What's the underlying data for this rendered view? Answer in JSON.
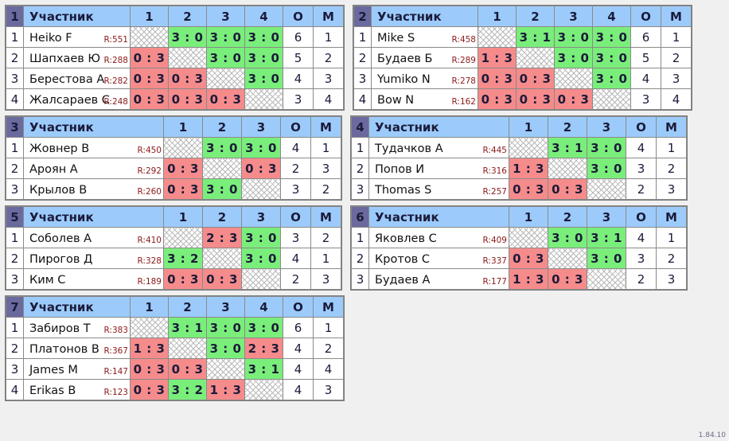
{
  "app": {
    "version": "1.84.10",
    "headers": {
      "participant": "Участник",
      "points": "О",
      "place": "М"
    },
    "colors": {
      "header_blue": "#9ccbfb",
      "group_badge": "#6a6a9e",
      "win_green": "#7aee7a",
      "loss_red": "#f58b8b",
      "rating_text": "#8b1a1a",
      "page_background": "#f0f0f0"
    }
  },
  "groups": [
    {
      "number": "1",
      "opponent_columns": [
        "1",
        "2",
        "3",
        "4"
      ],
      "rows": [
        {
          "rank": "1",
          "name": "Heiko F",
          "rating": "R:551",
          "cells": [
            {
              "text": "",
              "state": "none"
            },
            {
              "text": "3 : 0",
              "state": "win"
            },
            {
              "text": "3 : 0",
              "state": "win"
            },
            {
              "text": "3 : 0",
              "state": "win"
            }
          ],
          "points": "6",
          "place": "1"
        },
        {
          "rank": "2",
          "name": "Шапхаев Ю",
          "rating": "R:288",
          "cells": [
            {
              "text": "0 : 3",
              "state": "loss"
            },
            {
              "text": "",
              "state": "none"
            },
            {
              "text": "3 : 0",
              "state": "win"
            },
            {
              "text": "3 : 0",
              "state": "win"
            }
          ],
          "points": "5",
          "place": "2"
        },
        {
          "rank": "3",
          "name": "Берестова А",
          "rating": "R:282",
          "cells": [
            {
              "text": "0 : 3",
              "state": "loss"
            },
            {
              "text": "0 : 3",
              "state": "loss"
            },
            {
              "text": "",
              "state": "none"
            },
            {
              "text": "3 : 0",
              "state": "win"
            }
          ],
          "points": "4",
          "place": "3"
        },
        {
          "rank": "4",
          "name": "Жалсараев С",
          "rating": "R:248",
          "cells": [
            {
              "text": "0 : 3",
              "state": "loss"
            },
            {
              "text": "0 : 3",
              "state": "loss"
            },
            {
              "text": "0 : 3",
              "state": "loss"
            },
            {
              "text": "",
              "state": "none"
            }
          ],
          "points": "3",
          "place": "4"
        }
      ]
    },
    {
      "number": "2",
      "opponent_columns": [
        "1",
        "2",
        "3",
        "4"
      ],
      "rows": [
        {
          "rank": "1",
          "name": "Mike S",
          "rating": "R:458",
          "cells": [
            {
              "text": "",
              "state": "none"
            },
            {
              "text": "3 : 1",
              "state": "win"
            },
            {
              "text": "3 : 0",
              "state": "win"
            },
            {
              "text": "3 : 0",
              "state": "win"
            }
          ],
          "points": "6",
          "place": "1"
        },
        {
          "rank": "2",
          "name": "Будаев Б",
          "rating": "R:289",
          "cells": [
            {
              "text": "1 : 3",
              "state": "loss"
            },
            {
              "text": "",
              "state": "none"
            },
            {
              "text": "3 : 0",
              "state": "win"
            },
            {
              "text": "3 : 0",
              "state": "win"
            }
          ],
          "points": "5",
          "place": "2"
        },
        {
          "rank": "3",
          "name": "Yumiko N",
          "rating": "R:278",
          "cells": [
            {
              "text": "0 : 3",
              "state": "loss"
            },
            {
              "text": "0 : 3",
              "state": "loss"
            },
            {
              "text": "",
              "state": "none"
            },
            {
              "text": "3 : 0",
              "state": "win"
            }
          ],
          "points": "4",
          "place": "3"
        },
        {
          "rank": "4",
          "name": "Bow N",
          "rating": "R:162",
          "cells": [
            {
              "text": "0 : 3",
              "state": "loss"
            },
            {
              "text": "0 : 3",
              "state": "loss"
            },
            {
              "text": "0 : 3",
              "state": "loss"
            },
            {
              "text": "",
              "state": "none"
            }
          ],
          "points": "3",
          "place": "4"
        }
      ]
    },
    {
      "number": "3",
      "opponent_columns": [
        "1",
        "2",
        "3"
      ],
      "rows": [
        {
          "rank": "1",
          "name": "Жовнер В",
          "rating": "R:450",
          "cells": [
            {
              "text": "",
              "state": "none"
            },
            {
              "text": "3 : 0",
              "state": "win"
            },
            {
              "text": "3 : 0",
              "state": "win"
            }
          ],
          "points": "4",
          "place": "1"
        },
        {
          "rank": "2",
          "name": "Ароян А",
          "rating": "R:292",
          "cells": [
            {
              "text": "0 : 3",
              "state": "loss"
            },
            {
              "text": "",
              "state": "none"
            },
            {
              "text": "0 : 3",
              "state": "loss"
            }
          ],
          "points": "2",
          "place": "3"
        },
        {
          "rank": "3",
          "name": "Крылов В",
          "rating": "R:260",
          "cells": [
            {
              "text": "0 : 3",
              "state": "loss"
            },
            {
              "text": "3 : 0",
              "state": "win"
            },
            {
              "text": "",
              "state": "none"
            }
          ],
          "points": "3",
          "place": "2"
        }
      ]
    },
    {
      "number": "4",
      "opponent_columns": [
        "1",
        "2",
        "3"
      ],
      "rows": [
        {
          "rank": "1",
          "name": "Тудачков А",
          "rating": "R:445",
          "cells": [
            {
              "text": "",
              "state": "none"
            },
            {
              "text": "3 : 1",
              "state": "win"
            },
            {
              "text": "3 : 0",
              "state": "win"
            }
          ],
          "points": "4",
          "place": "1"
        },
        {
          "rank": "2",
          "name": "Попов И",
          "rating": "R:316",
          "cells": [
            {
              "text": "1 : 3",
              "state": "loss"
            },
            {
              "text": "",
              "state": "none"
            },
            {
              "text": "3 : 0",
              "state": "win"
            }
          ],
          "points": "3",
          "place": "2"
        },
        {
          "rank": "3",
          "name": "Thomas S",
          "rating": "R:257",
          "cells": [
            {
              "text": "0 : 3",
              "state": "loss"
            },
            {
              "text": "0 : 3",
              "state": "loss"
            },
            {
              "text": "",
              "state": "none"
            }
          ],
          "points": "2",
          "place": "3"
        }
      ]
    },
    {
      "number": "5",
      "opponent_columns": [
        "1",
        "2",
        "3"
      ],
      "rows": [
        {
          "rank": "1",
          "name": "Соболев А",
          "rating": "R:410",
          "cells": [
            {
              "text": "",
              "state": "none"
            },
            {
              "text": "2 : 3",
              "state": "loss"
            },
            {
              "text": "3 : 0",
              "state": "win"
            }
          ],
          "points": "3",
          "place": "2"
        },
        {
          "rank": "2",
          "name": "Пирогов Д",
          "rating": "R:328",
          "cells": [
            {
              "text": "3 : 2",
              "state": "win"
            },
            {
              "text": "",
              "state": "none"
            },
            {
              "text": "3 : 0",
              "state": "win"
            }
          ],
          "points": "4",
          "place": "1"
        },
        {
          "rank": "3",
          "name": "Ким С",
          "rating": "R:189",
          "cells": [
            {
              "text": "0 : 3",
              "state": "loss"
            },
            {
              "text": "0 : 3",
              "state": "loss"
            },
            {
              "text": "",
              "state": "none"
            }
          ],
          "points": "2",
          "place": "3"
        }
      ]
    },
    {
      "number": "6",
      "opponent_columns": [
        "1",
        "2",
        "3"
      ],
      "rows": [
        {
          "rank": "1",
          "name": "Яковлев С",
          "rating": "R:409",
          "cells": [
            {
              "text": "",
              "state": "none"
            },
            {
              "text": "3 : 0",
              "state": "win"
            },
            {
              "text": "3 : 1",
              "state": "win"
            }
          ],
          "points": "4",
          "place": "1"
        },
        {
          "rank": "2",
          "name": "Кротов С",
          "rating": "R:337",
          "cells": [
            {
              "text": "0 : 3",
              "state": "loss"
            },
            {
              "text": "",
              "state": "none"
            },
            {
              "text": "3 : 0",
              "state": "win"
            }
          ],
          "points": "3",
          "place": "2"
        },
        {
          "rank": "3",
          "name": "Будаев А",
          "rating": "R:177",
          "cells": [
            {
              "text": "1 : 3",
              "state": "loss"
            },
            {
              "text": "0 : 3",
              "state": "loss"
            },
            {
              "text": "",
              "state": "none"
            }
          ],
          "points": "2",
          "place": "3"
        }
      ]
    },
    {
      "number": "7",
      "opponent_columns": [
        "1",
        "2",
        "3",
        "4"
      ],
      "rows": [
        {
          "rank": "1",
          "name": "Забиров Т",
          "rating": "R:383",
          "cells": [
            {
              "text": "",
              "state": "none"
            },
            {
              "text": "3 : 1",
              "state": "win"
            },
            {
              "text": "3 : 0",
              "state": "win"
            },
            {
              "text": "3 : 0",
              "state": "win"
            }
          ],
          "points": "6",
          "place": "1"
        },
        {
          "rank": "2",
          "name": "Платонов В",
          "rating": "R:367",
          "cells": [
            {
              "text": "1 : 3",
              "state": "loss"
            },
            {
              "text": "",
              "state": "none"
            },
            {
              "text": "3 : 0",
              "state": "win"
            },
            {
              "text": "2 : 3",
              "state": "loss"
            }
          ],
          "points": "4",
          "place": "2"
        },
        {
          "rank": "3",
          "name": "James M",
          "rating": "R:147",
          "cells": [
            {
              "text": "0 : 3",
              "state": "loss"
            },
            {
              "text": "0 : 3",
              "state": "loss"
            },
            {
              "text": "",
              "state": "none"
            },
            {
              "text": "3 : 1",
              "state": "win"
            }
          ],
          "points": "4",
          "place": "4"
        },
        {
          "rank": "4",
          "name": "Erikas B",
          "rating": "R:123",
          "cells": [
            {
              "text": "0 : 3",
              "state": "loss"
            },
            {
              "text": "3 : 2",
              "state": "win"
            },
            {
              "text": "1 : 3",
              "state": "loss"
            },
            {
              "text": "",
              "state": "none"
            }
          ],
          "points": "4",
          "place": "3"
        }
      ]
    }
  ]
}
